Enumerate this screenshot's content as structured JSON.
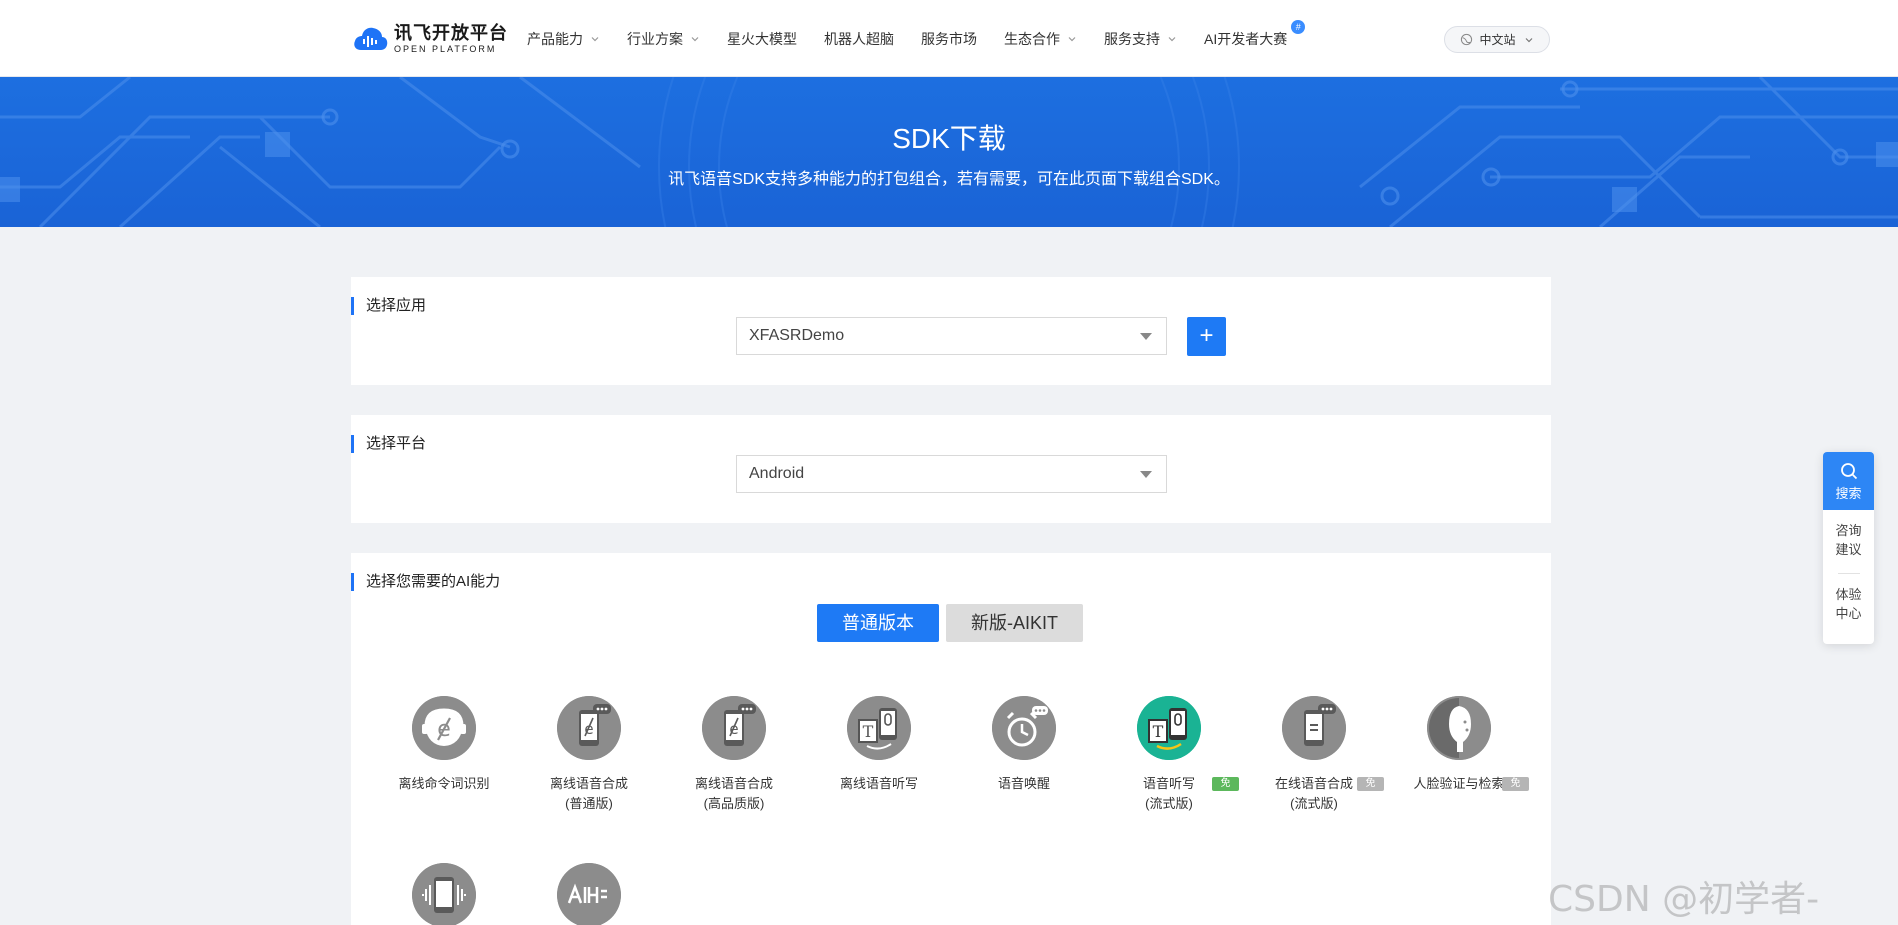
{
  "nav": {
    "logo_cn": "讯飞开放平台",
    "logo_en": "OPEN PLATFORM",
    "items": [
      {
        "label": "产品能力",
        "dropdown": true
      },
      {
        "label": "行业方案",
        "dropdown": true
      },
      {
        "label": "星火大模型",
        "dropdown": false
      },
      {
        "label": "机器人超脑",
        "dropdown": false
      },
      {
        "label": "服务市场",
        "dropdown": false
      },
      {
        "label": "生态合作",
        "dropdown": true
      },
      {
        "label": "服务支持",
        "dropdown": true
      },
      {
        "label": "AI开发者大赛",
        "dropdown": false
      }
    ],
    "contest_badge": "#",
    "lang": "中文站"
  },
  "banner": {
    "title": "SDK下载",
    "subtitle": "讯飞语音SDK支持多种能力的打包组合，若有需要，可在此页面下载组合SDK。"
  },
  "app_section": {
    "title": "选择应用",
    "selected": "XFASRDemo",
    "add_label": "+"
  },
  "platform_section": {
    "title": "选择平台",
    "selected": "Android"
  },
  "ability_section": {
    "title": "选择您需要的AI能力",
    "tabs": [
      {
        "label": "普通版本",
        "active": true
      },
      {
        "label": "新版-AIKIT",
        "active": false
      }
    ],
    "abilities": [
      {
        "name": "离线命令词识别",
        "sub": "",
        "tag": "",
        "selected": false
      },
      {
        "name": "离线语音合成",
        "sub": "(普通版)",
        "tag": "",
        "selected": false
      },
      {
        "name": "离线语音合成",
        "sub": "(高品质版)",
        "tag": "",
        "selected": false
      },
      {
        "name": "离线语音听写",
        "sub": "",
        "tag": "",
        "selected": false
      },
      {
        "name": "语音唤醒",
        "sub": "",
        "tag": "",
        "selected": false
      },
      {
        "name": "语音听写",
        "sub": "(流式版)",
        "tag": "免费",
        "selected": true
      },
      {
        "name": "在线语音合成",
        "sub": "(流式版)",
        "tag": "免费",
        "selected": false
      },
      {
        "name": "人脸验证与检索",
        "sub": "",
        "tag": "免费",
        "selected": false
      }
    ]
  },
  "floatbar": {
    "search": "搜索",
    "consult_1": "咨询",
    "consult_2": "建议",
    "exp_1": "体验",
    "exp_2": "中心"
  },
  "watermark": "CSDN @初学者-Study",
  "colors": {
    "primary": "#1e7af5",
    "banner": "#1d6fe0",
    "selected_ability": "#1ab394",
    "tag_green": "#5cb85c",
    "tag_gray": "#b5b5b5"
  }
}
